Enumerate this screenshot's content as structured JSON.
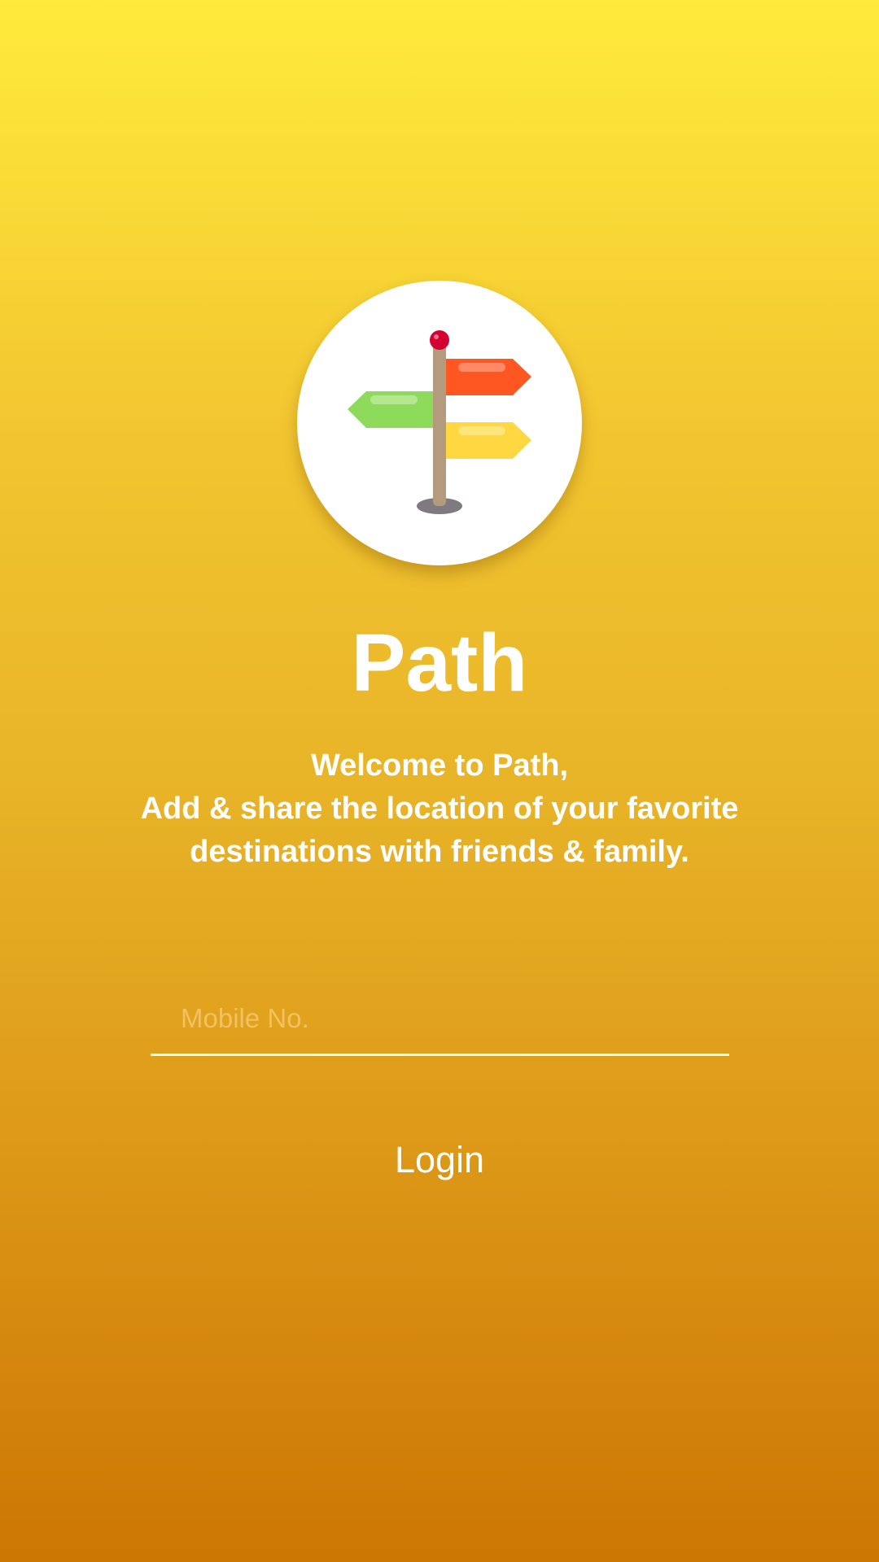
{
  "app": {
    "title": "Path"
  },
  "logo": {
    "icon": "signpost-icon",
    "colors": {
      "pin": "#D50032",
      "pole": "#B59B7E",
      "base": "#7E7A80",
      "sign_right_top": "#FF5722",
      "sign_left": "#8EDB5C",
      "sign_right_bottom": "#FFD740"
    }
  },
  "welcome": {
    "line1": "Welcome to Path,",
    "line2": "Add & share the location of your favorite",
    "line3": "destinations with friends & family."
  },
  "mobile_input": {
    "placeholder": "Mobile No.",
    "value": ""
  },
  "login": {
    "label": "Login"
  },
  "colors": {
    "gradient_top": "#FFEB3B",
    "gradient_bottom": "#CC7604",
    "text": "#FFFFFF"
  }
}
